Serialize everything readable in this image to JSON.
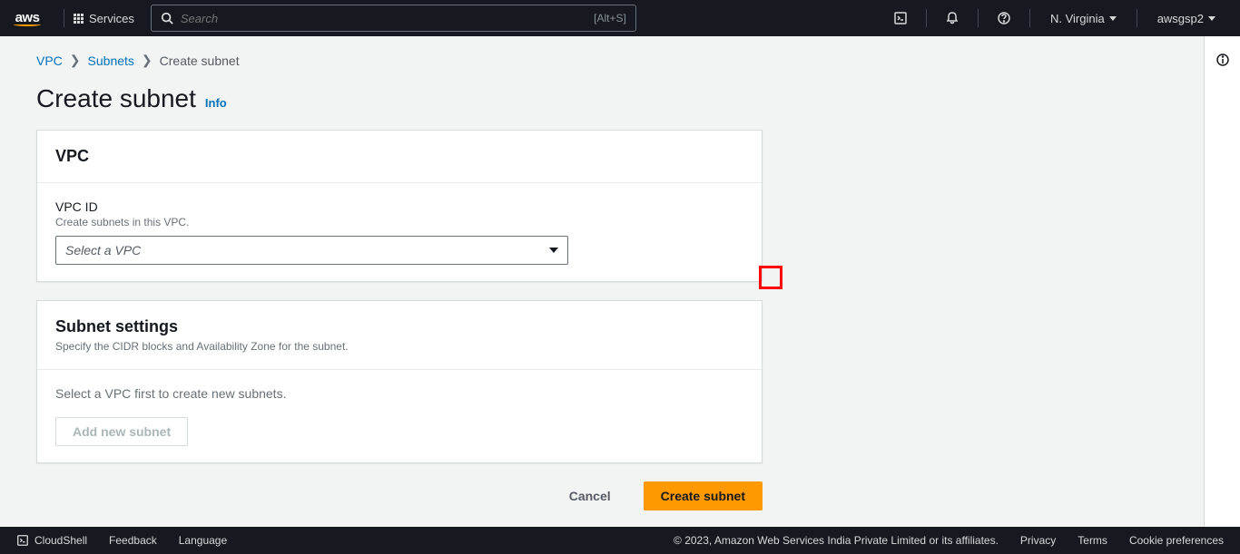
{
  "nav": {
    "services_label": "Services",
    "search_placeholder": "Search",
    "search_shortcut": "[Alt+S]",
    "region": "N. Virginia",
    "account": "awsgsp2"
  },
  "breadcrumbs": {
    "vpc": "VPC",
    "subnets": "Subnets",
    "current": "Create subnet"
  },
  "page": {
    "title": "Create subnet",
    "info_label": "Info"
  },
  "vpc_panel": {
    "title": "VPC",
    "id_label": "VPC ID",
    "id_hint": "Create subnets in this VPC.",
    "select_placeholder": "Select a VPC"
  },
  "subnet_panel": {
    "title": "Subnet settings",
    "subtitle": "Specify the CIDR blocks and Availability Zone for the subnet.",
    "empty_msg": "Select a VPC first to create new subnets.",
    "add_btn": "Add new subnet"
  },
  "actions": {
    "cancel": "Cancel",
    "create": "Create subnet"
  },
  "footer": {
    "cloudshell": "CloudShell",
    "feedback": "Feedback",
    "language": "Language",
    "copyright": "© 2023, Amazon Web Services India Private Limited or its affiliates.",
    "privacy": "Privacy",
    "terms": "Terms",
    "cookies": "Cookie preferences"
  }
}
